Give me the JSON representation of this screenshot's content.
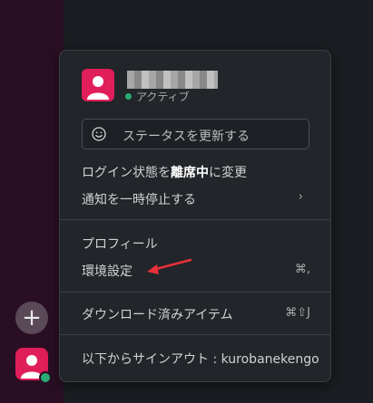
{
  "user": {
    "status_text": "アクティブ"
  },
  "status_field": {
    "placeholder": "ステータスを更新する"
  },
  "menu": {
    "away_prefix": "ログイン状態を",
    "away_bold": "離席中",
    "away_suffix": "に変更",
    "pause_notifications": "通知を一時停止する",
    "pause_chevron": "›",
    "profile": "プロフィール",
    "preferences": "環境設定",
    "preferences_shortcut": "⌘,",
    "downloads": "ダウンロード済みアイテム",
    "downloads_shortcut": "⌘⇧J",
    "sign_out": "以下からサインアウト : kurobanekengo"
  },
  "sidebar": {
    "add_label": "+"
  },
  "colors": {
    "avatar": "#e01e5a",
    "presence": "#2bac76",
    "annotation_arrow": "#e8303a"
  },
  "icons": {
    "status": "smile-icon",
    "add": "plus-icon",
    "annotation": "red-arrow-icon"
  }
}
